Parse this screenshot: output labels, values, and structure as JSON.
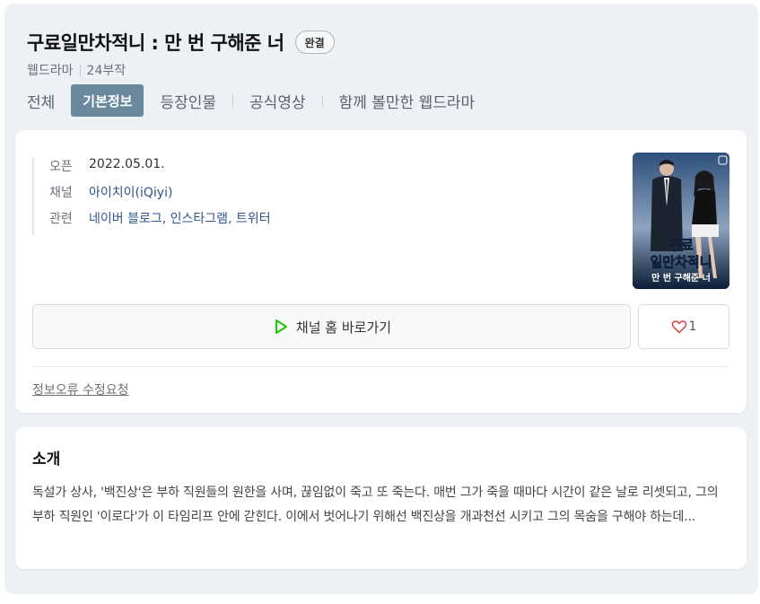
{
  "header": {
    "title": "구료일만차적니 : 만 번 구해준 너",
    "status_badge": "완결",
    "genre": "웹드라마",
    "episodes": "24부작"
  },
  "tabs": [
    {
      "label": "전체",
      "active": false
    },
    {
      "label": "기본정보",
      "active": true
    },
    {
      "label": "등장인물",
      "active": false
    },
    {
      "label": "공식영상",
      "active": false
    },
    {
      "label": "함께 볼만한 웹드라마",
      "active": false
    }
  ],
  "info": {
    "open_label": "오픈",
    "open_value": "2022.05.01.",
    "channel_label": "채널",
    "channel_value": "아이치이(iQiyi)",
    "related_label": "관련",
    "related_value": "네이버 블로그, 인스타그램, 트위터"
  },
  "poster": {
    "text_line1": "구료",
    "text_line2": "일만차적니",
    "text_line3": "만 번 구해준 너"
  },
  "actions": {
    "channel_home_label": "채널 홈 바로가기",
    "like_count": "1",
    "report_label": "정보오류 수정요청"
  },
  "intro": {
    "title": "소개",
    "text": "독설가 상사, '백진상'은 부하 직원들의 원한을 사며, 끊임없이 죽고 또 죽는다. 매번 그가 죽을 때마다 시간이 같은 날로 리셋되고, 그의 부하 직원인 '이로다'가 이 타임리프 안에 갇힌다. 이에서 벗어나기 위해선 백진상을 개과천선 시키고 그의 목숨을 구해야 하는데..."
  },
  "colors": {
    "panel_bg": "#edf0f4",
    "active_tab": "#6a899c",
    "link": "#2f5391",
    "play_icon": "#1ec800",
    "heart_icon": "#e2403a"
  }
}
